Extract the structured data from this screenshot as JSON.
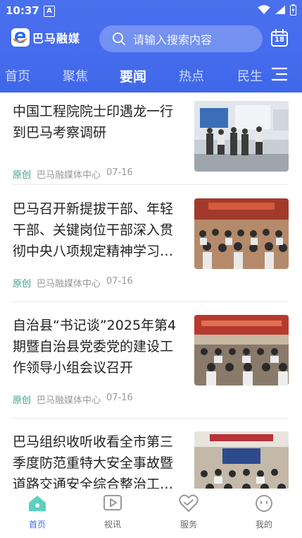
{
  "status": {
    "time": "10:37",
    "indicator": "A"
  },
  "header": {
    "logo_text": "巴马融媒",
    "search_placeholder": "请输入搜索内容",
    "calendar_day": "18"
  },
  "tabs": [
    {
      "label": "首页"
    },
    {
      "label": "聚焦"
    },
    {
      "label": "要闻",
      "active": true
    },
    {
      "label": "热点"
    },
    {
      "label": "民生"
    }
  ],
  "articles": [
    {
      "title": "中国工程院院士印遇龙一行到巴马考察调研",
      "tag": "原创",
      "source": "巴马融媒体中心",
      "date": "07-16"
    },
    {
      "title": "巴马召开新提拔干部、年轻干部、关键岗位干部深入贯彻中央八项规定精神学习…",
      "tag": "原创",
      "source": "巴马融媒体中心",
      "date": "07-16"
    },
    {
      "title": "自治县“书记谈”2025年第4期暨自治县党委党的建设工作领导小组会议召开",
      "tag": "原创",
      "source": "巴马融媒体中心",
      "date": "07-16"
    },
    {
      "title": "巴马组织收听收看全市第三季度防范重特大安全事故暨道路交通安全综合整治工…",
      "tag": "",
      "source": "",
      "date": ""
    }
  ],
  "bottom_nav": [
    {
      "label": "首页",
      "icon": "home-icon",
      "active": true
    },
    {
      "label": "视讯",
      "icon": "video-icon"
    },
    {
      "label": "服务",
      "icon": "service-icon"
    },
    {
      "label": "我的",
      "icon": "profile-icon"
    }
  ],
  "colors": {
    "brand": "#4169ea",
    "accent_green": "#3a9f87"
  }
}
